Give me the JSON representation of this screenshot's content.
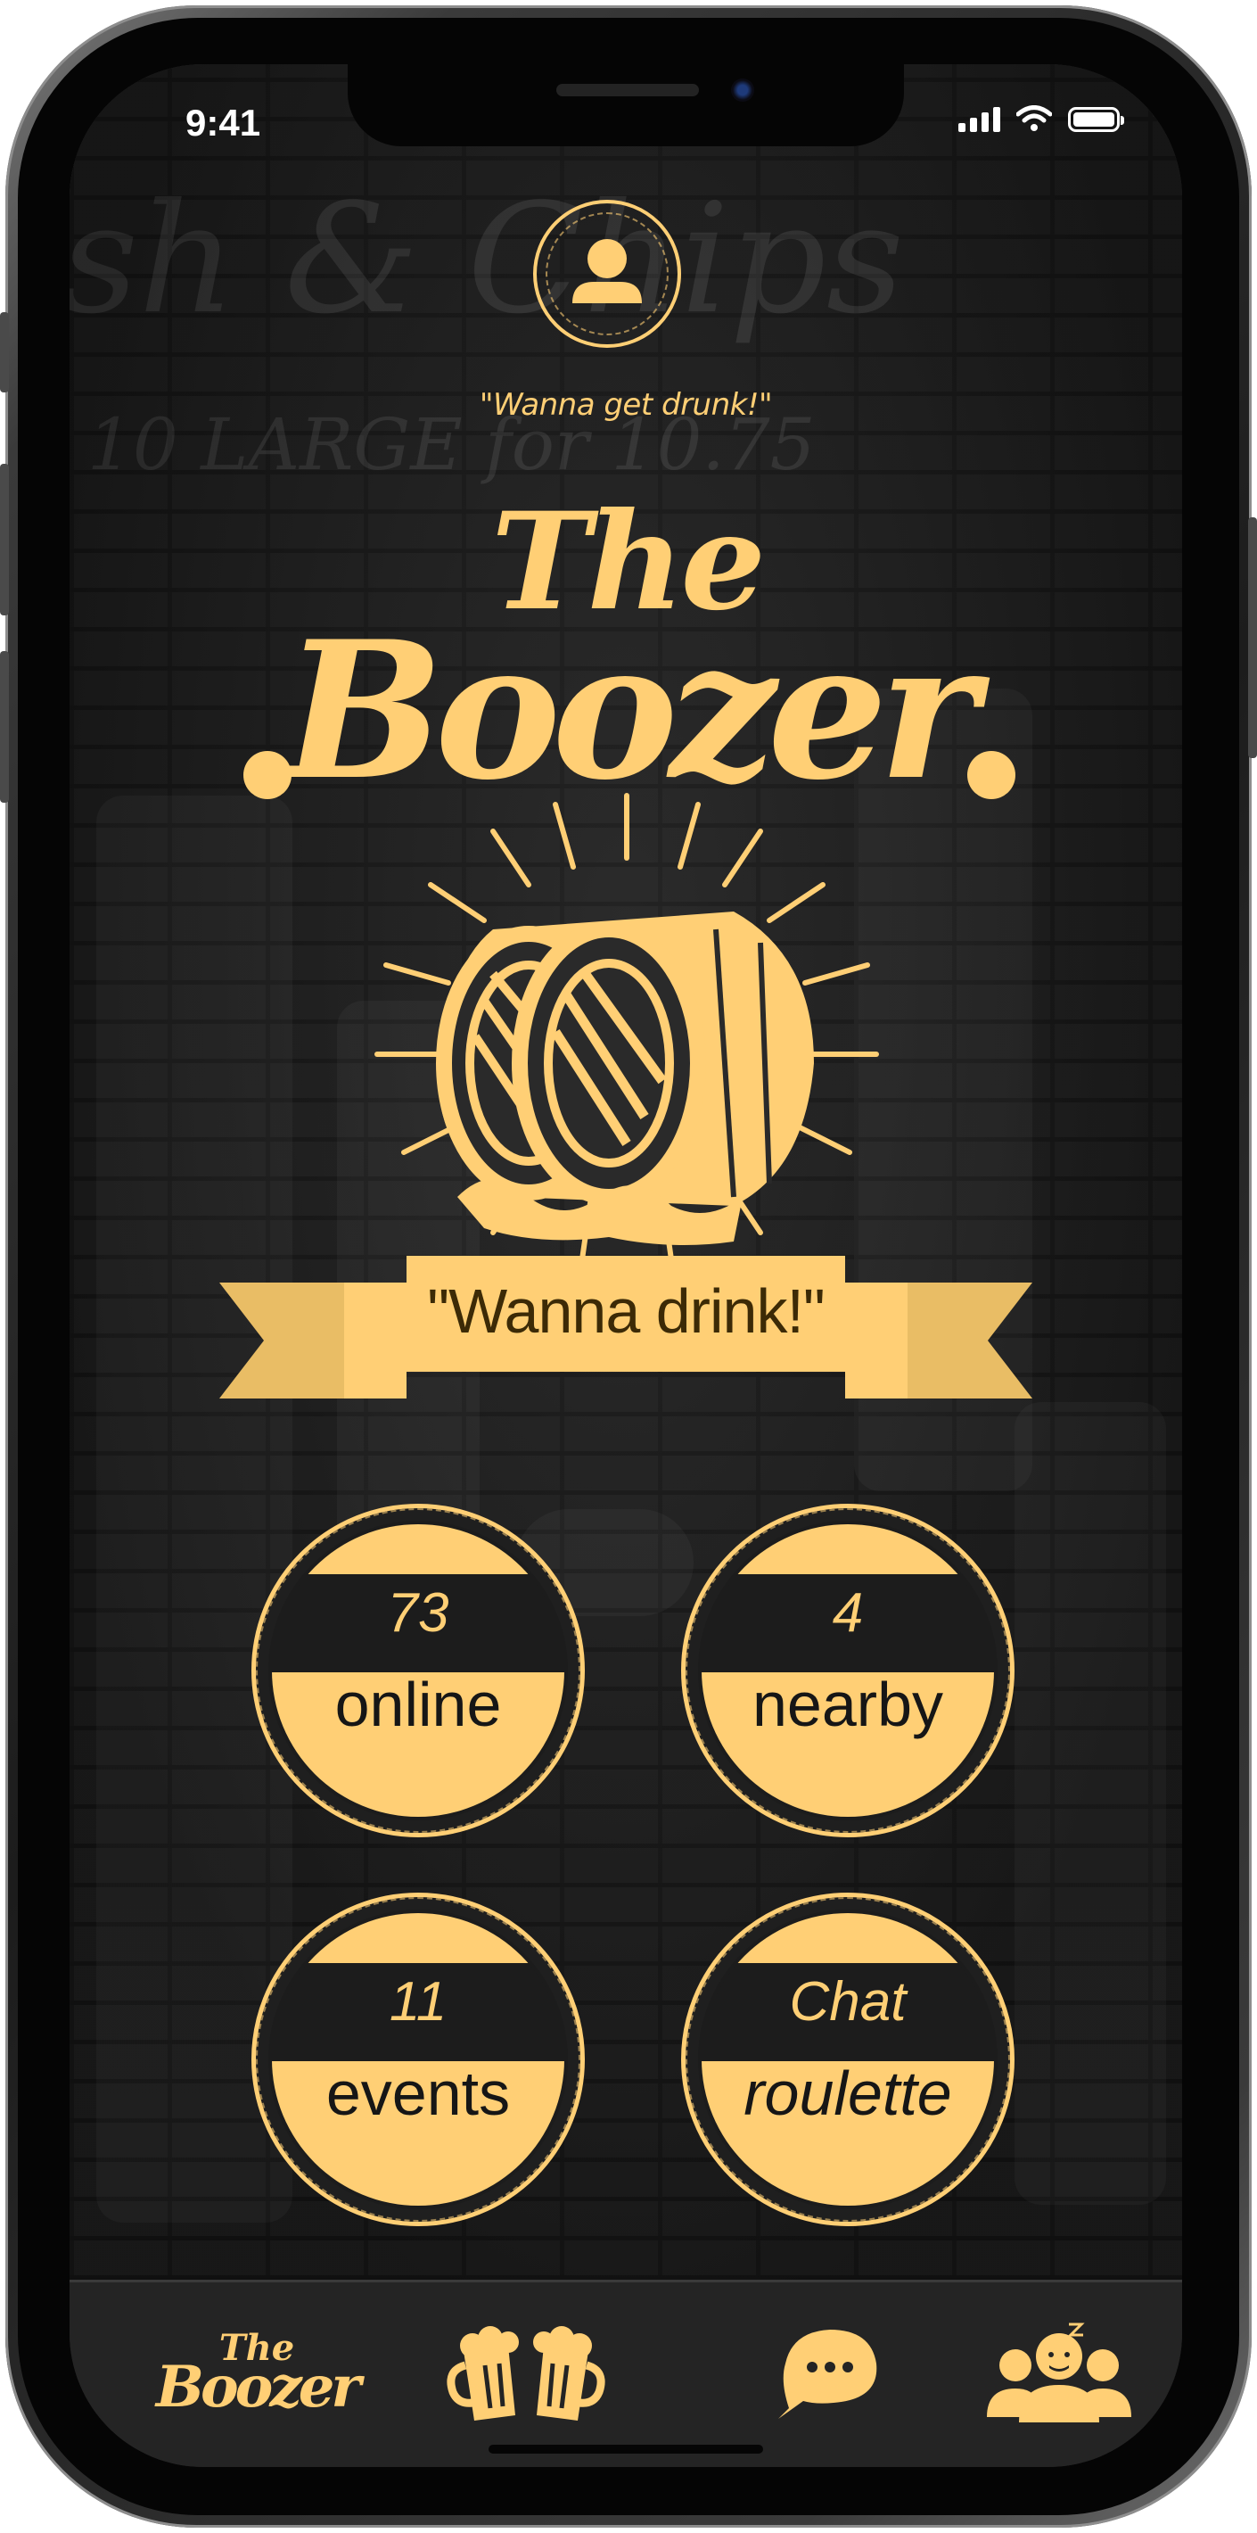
{
  "status_bar": {
    "time": "9:41"
  },
  "profile": {
    "tagline": "\"Wanna get drunk!\""
  },
  "logo": {
    "line1": "The",
    "line2": "Boozer"
  },
  "banner": {
    "text": "\"Wanna drink!\""
  },
  "badges": [
    {
      "number": "73",
      "label": "online"
    },
    {
      "number": "4",
      "label": "nearby"
    },
    {
      "number": "11",
      "label": "events"
    },
    {
      "number": "Chat",
      "label": "roulette"
    }
  ],
  "tab_bar": {
    "home": {
      "line1": "The",
      "line2": "Boozer"
    },
    "icons": [
      "beer-mugs-icon",
      "chat-bubble-icon",
      "friends-icon"
    ]
  },
  "colors": {
    "accent": "#ffcf75",
    "dark_text": "#3c2a06",
    "background": "#242424"
  }
}
